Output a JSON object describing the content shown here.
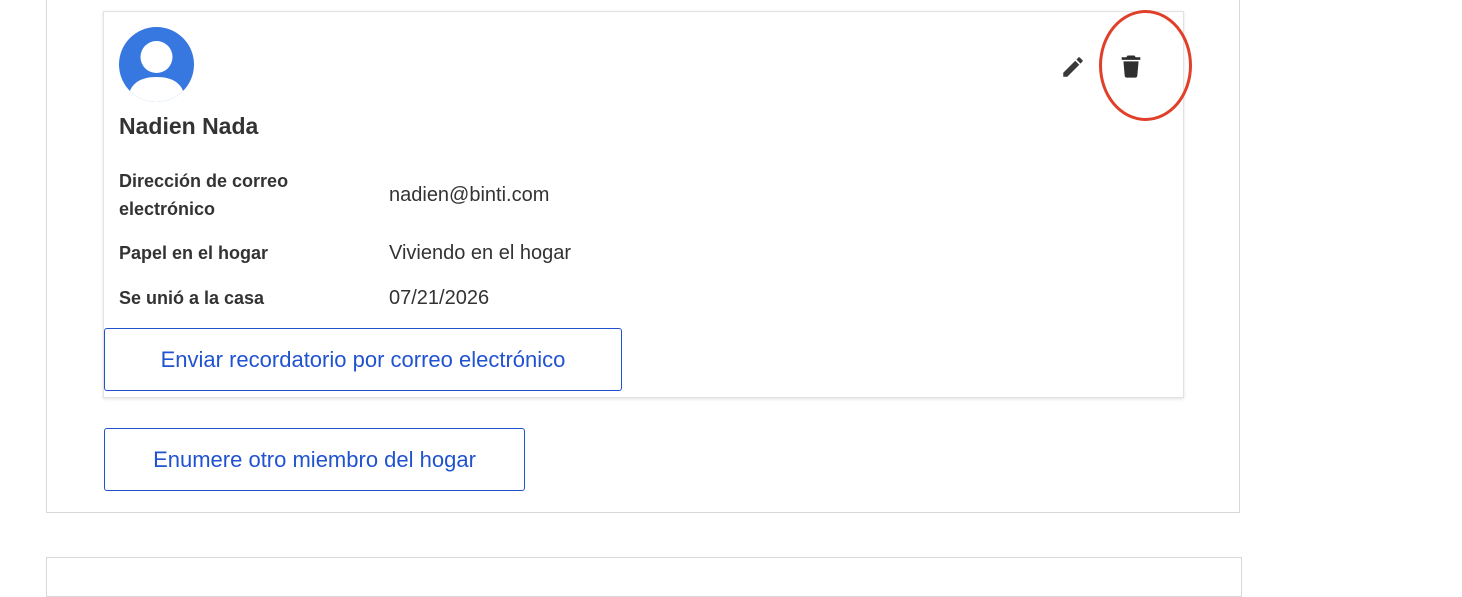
{
  "member": {
    "name": "Nadien Nada",
    "fields": [
      {
        "label": "Dirección de correo electrónico",
        "value": "nadien@binti.com"
      },
      {
        "label": "Papel en el hogar",
        "value": "Viviendo en el hogar"
      },
      {
        "label": "Se unió a la casa",
        "value": "07/21/2026"
      }
    ],
    "actions": {
      "edit_icon": "pencil-icon",
      "delete_icon": "trash-icon"
    },
    "reminder_button": "Enviar recordatorio por correo electrónico"
  },
  "add_member_button": "Enumere otro miembro del hogar",
  "colors": {
    "avatar": "#3777e0",
    "button_text": "#2153d0",
    "highlight": "#e0402a"
  }
}
